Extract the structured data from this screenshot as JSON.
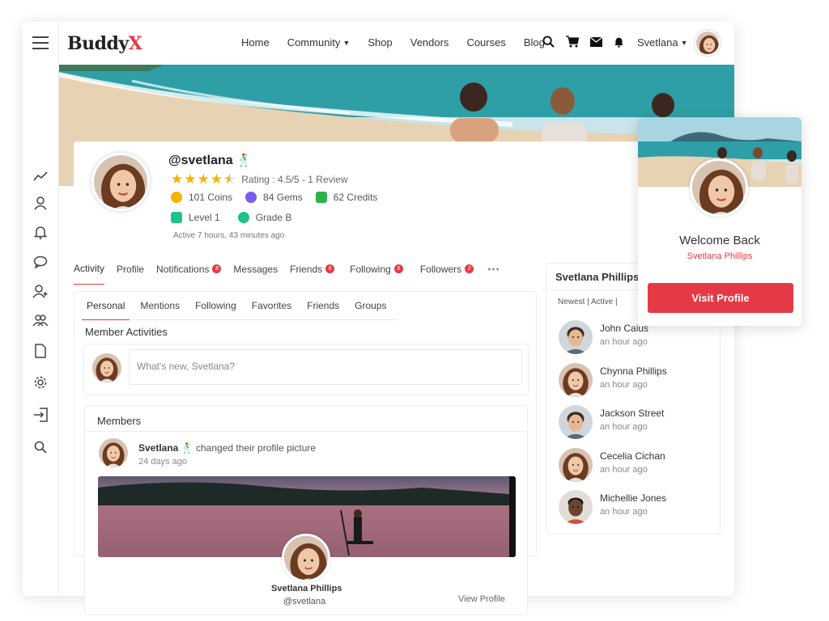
{
  "app": {
    "logo_main": "Buddy",
    "logo_accent": "X"
  },
  "nav": {
    "items": [
      "Home",
      "Community",
      "Shop",
      "Vendors",
      "Courses",
      "Blog"
    ],
    "user_name": "Svetlana"
  },
  "profile": {
    "handle": "@svetlana",
    "rating_text": "Rating : 4.5/5 - 1 Review",
    "rating_value": 4.5,
    "coins": "101 Coins",
    "gems": "84 Gems",
    "credits": "62 Credits",
    "level": "Level 1",
    "grade": "Grade B",
    "active": "Active 7 hours, 43 minutes ago"
  },
  "tabs": [
    {
      "label": "Activity",
      "badge": ""
    },
    {
      "label": "Profile",
      "badge": ""
    },
    {
      "label": "Notifications",
      "badge": "8"
    },
    {
      "label": "Messages",
      "badge": ""
    },
    {
      "label": "Friends",
      "badge": "6"
    },
    {
      "label": "Following",
      "badge": "6"
    },
    {
      "label": "Followers",
      "badge": "2"
    }
  ],
  "subtabs": [
    "Personal",
    "Mentions",
    "Following",
    "Favorites",
    "Friends",
    "Groups"
  ],
  "feed": {
    "section_title": "Member Activities",
    "post_placeholder": "What's new, Svetlana?"
  },
  "members": {
    "header": "Members",
    "author": "Svetlana",
    "action": "changed their profile picture",
    "time": "24 days ago",
    "full_name": "Svetlana Phillips",
    "handle": "@svetlana",
    "view_profile": "View Profile"
  },
  "right_panel": {
    "title": "Svetlana Phillips",
    "filters": "Newest  |  Active  |",
    "people": [
      {
        "name": "John Caius",
        "time": "an hour ago"
      },
      {
        "name": "Chynna Phillips",
        "time": "an hour ago"
      },
      {
        "name": "Jackson Street",
        "time": "an hour ago"
      },
      {
        "name": "Cecelia Cichan",
        "time": "an hour ago"
      },
      {
        "name": "Michellie Jones",
        "time": "an hour ago"
      }
    ]
  },
  "welcome": {
    "title": "Welcome Back",
    "name": "Svetlana Phillips",
    "button": "Visit Profile"
  },
  "colors": {
    "accent": "#e63946",
    "star": "#f5b301"
  }
}
